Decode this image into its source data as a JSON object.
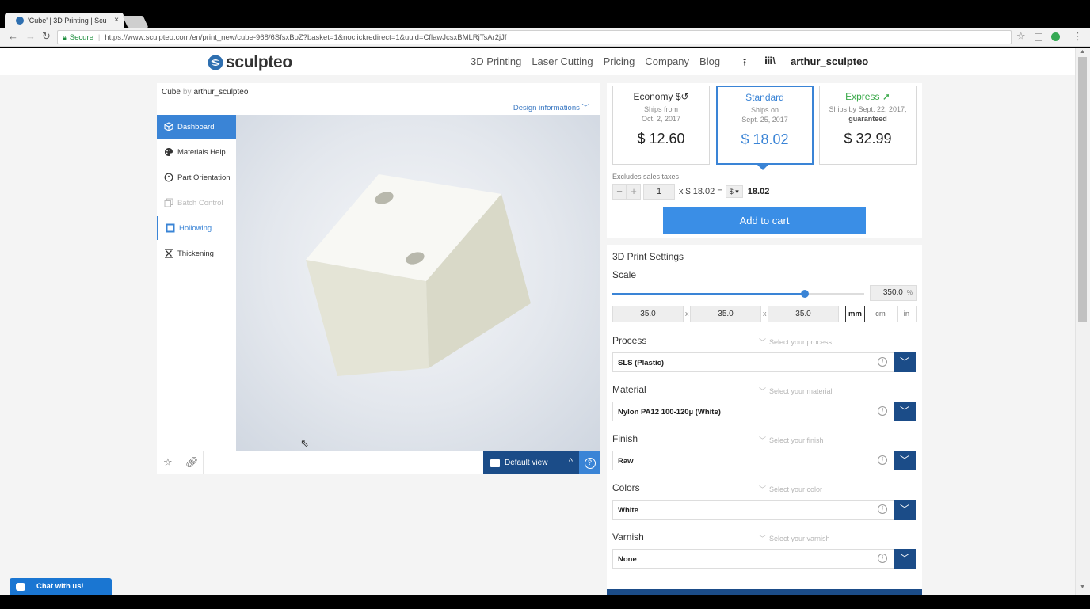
{
  "browser": {
    "tab_title": "'Cube' | 3D Printing | Scu",
    "tab_close": "×",
    "secure_label": "Secure",
    "url": "https://www.sculpteo.com/en/print_new/cube-968/6SfsxBoZ?basket=1&noclickredirect=1&uuid=CflawJcsxBMLRjTsAr2jJf",
    "star_icon": "☆",
    "menu_icon": "⋮"
  },
  "header": {
    "logo_text": "sculpteo",
    "nav": [
      "3D Printing",
      "Laser Cutting",
      "Pricing",
      "Company",
      "Blog"
    ],
    "username": "arthur_sculpteo"
  },
  "design": {
    "name": "Cube",
    "by": "by",
    "author": "arthur_sculpteo",
    "info_link": "Design informations ﹀"
  },
  "sidebar": {
    "items": [
      {
        "label": "Dashboard",
        "icon": "cube-icon"
      },
      {
        "label": "Materials Help",
        "icon": "palette-icon"
      },
      {
        "label": "Part Orientation",
        "icon": "rotate-icon"
      },
      {
        "label": "Batch Control",
        "icon": "copy-icon"
      },
      {
        "label": "Hollowing",
        "icon": "hollow-square-icon"
      },
      {
        "label": "Thickening",
        "icon": "thickness-icon"
      }
    ]
  },
  "viewer": {
    "default_view_label": "Default view",
    "chevron": "^",
    "help": "?"
  },
  "pricing": {
    "tiers": [
      {
        "name": "Economy",
        "ship_line1": "Ships from",
        "ship_line2": "Oct. 2, 2017",
        "ship_line3": "",
        "price": "$ 12.60"
      },
      {
        "name": "Standard",
        "ship_line1": "Ships on",
        "ship_line2": "Sept. 25, 2017",
        "ship_line3": "",
        "price": "$ 18.02"
      },
      {
        "name": "Express",
        "ship_line1": "Ships by Sept. 22, 2017,",
        "ship_line2": "guaranteed",
        "ship_line3": "",
        "price": "$ 32.99"
      }
    ],
    "tax_note": "Excludes sales taxes",
    "qty_minus": "−",
    "qty_plus": "+",
    "quantity": "1",
    "times_price": "x $ 18.02 =",
    "currency": "$ ▾",
    "total": "18.02",
    "add_to_cart": "Add to cart"
  },
  "settings": {
    "title": "3D Print Settings",
    "scale_label": "Scale",
    "scale_percent": 350.0,
    "scale_value": "350.0",
    "scale_unit": "%",
    "slider_fraction": 0.765,
    "dims": [
      "35.0",
      "35.0",
      "35.0"
    ],
    "dim_sep": "x",
    "units": [
      "mm",
      "cm",
      "in"
    ],
    "options": [
      {
        "label": "Process",
        "hint": "Select your process",
        "value": "SLS (Plastic)"
      },
      {
        "label": "Material",
        "hint": "Select your material",
        "value": "Nylon PA12 100-120µ (White)"
      },
      {
        "label": "Finish",
        "hint": "Select your finish",
        "value": "Raw"
      },
      {
        "label": "Colors",
        "hint": "Select your color",
        "value": "White"
      },
      {
        "label": "Varnish",
        "hint": "Select your varnish",
        "value": "None"
      }
    ],
    "info_glyph": "i",
    "drop_glyph": "﹀"
  },
  "chat": {
    "label": "Chat with us!"
  },
  "colors": {
    "accent": "#3a84d6",
    "dark_blue": "#1b4c88",
    "express_green": "#3aa94a",
    "cart_blue": "#3a8ee6"
  }
}
